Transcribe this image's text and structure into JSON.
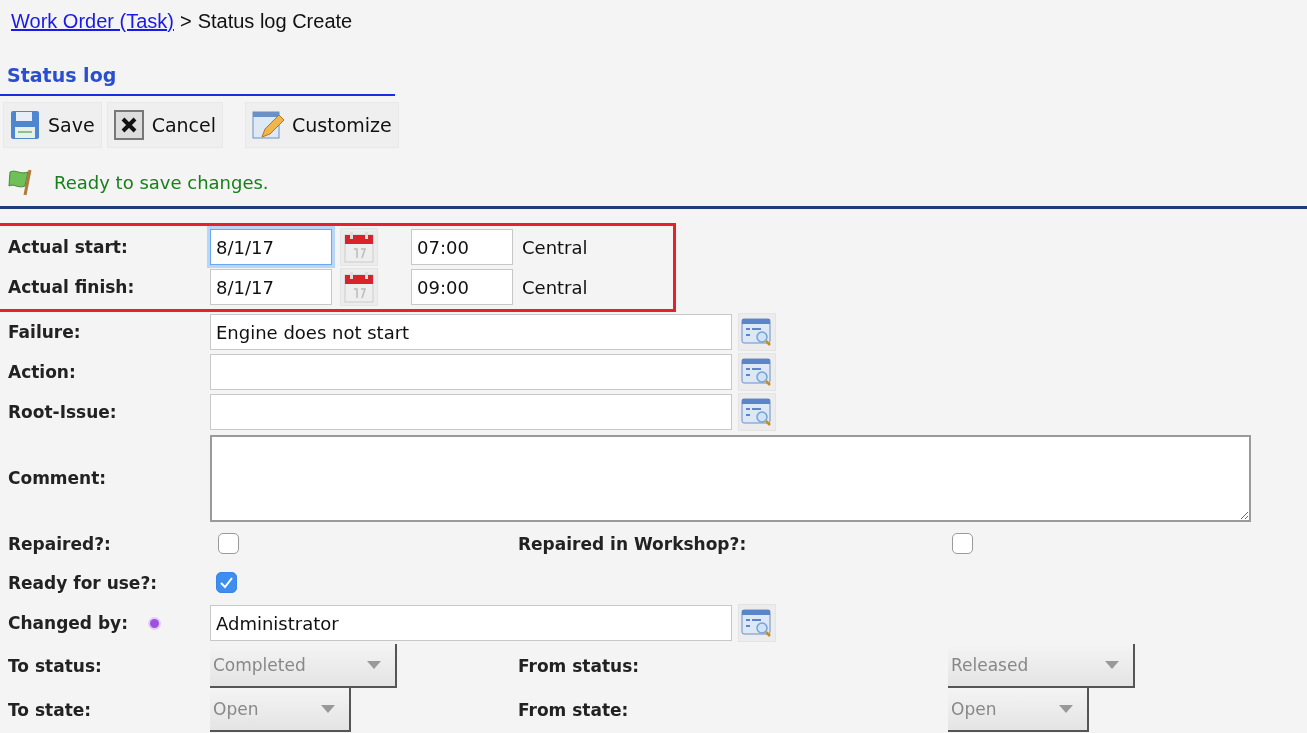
{
  "breadcrumb": {
    "link": "Work Order (Task)",
    "separator": ">",
    "current": "Status log Create"
  },
  "section_title": "Status log",
  "toolbar": [
    {
      "kind": "save",
      "label": "Save"
    },
    {
      "kind": "cancel",
      "label": "Cancel"
    },
    {
      "kind": "customize",
      "label": "Customize"
    }
  ],
  "status_message": "Ready to save changes.",
  "date_rows": [
    {
      "label": "Actual start:",
      "date": "8/1/17",
      "time": "07:00",
      "timezone": "Central",
      "focused": true
    },
    {
      "label": "Actual finish:",
      "date": "8/1/17",
      "time": "09:00",
      "timezone": "Central",
      "focused": false
    }
  ],
  "lookup_rows": [
    {
      "label": "Failure:",
      "value": "Engine does not start"
    },
    {
      "label": "Action:"
    },
    {
      "label": "Root-Issue:"
    }
  ],
  "comment": {
    "label": "Comment:"
  },
  "checkbox_rows": [
    [
      {
        "label": "Repaired?:",
        "checked": false
      },
      {
        "label": "Repaired in Workshop?:",
        "checked": false
      }
    ],
    [
      {
        "label": "Ready for use?:",
        "checked": true
      }
    ]
  ],
  "changed_by": {
    "label": "Changed by:",
    "value": "Administrator",
    "color": "#a14fe0"
  },
  "select_rows": [
    [
      {
        "label": "To status:",
        "value": "Completed",
        "disabled": true
      },
      {
        "label": "From status:",
        "value": "Released",
        "disabled": true
      }
    ],
    [
      {
        "label": "To state:",
        "value": "Open",
        "disabled": true
      },
      {
        "label": "From state:",
        "value": "Open",
        "disabled": true
      }
    ]
  ]
}
